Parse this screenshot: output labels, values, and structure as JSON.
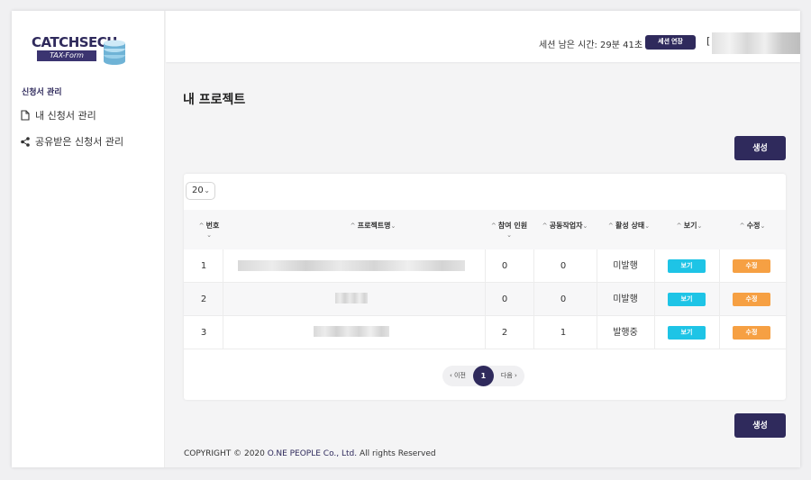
{
  "brand": {
    "logo_main": "CATCHSECU",
    "logo_sub": "TAX-Form"
  },
  "sidebar": {
    "section_title": "신청서 관리",
    "items": [
      {
        "label": "내 신청서 관리",
        "icon": "document-icon"
      },
      {
        "label": "공유받은 신청서 관리",
        "icon": "share-icon"
      }
    ]
  },
  "header": {
    "session_label": "세션 남은 시간:",
    "session_time": "29분 41초",
    "extend_button": "세션 연장",
    "bracket": "["
  },
  "main": {
    "title": "내 프로젝트",
    "create_button": "생성",
    "page_size": "20",
    "columns": [
      "번호",
      "프로젝트명",
      "참여 인원",
      "공동작업자",
      "활성 상태",
      "보기",
      "수정"
    ],
    "rows": [
      {
        "no": "1",
        "participants": "0",
        "collaborators": "0",
        "status": "미발행",
        "view": "보기",
        "edit": "수정"
      },
      {
        "no": "2",
        "participants": "0",
        "collaborators": "0",
        "status": "미발행",
        "view": "보기",
        "edit": "수정"
      },
      {
        "no": "3",
        "participants": "2",
        "collaborators": "1",
        "status": "발행중",
        "view": "보기",
        "edit": "수정"
      }
    ],
    "pagination": {
      "prev": "‹ 이전",
      "current": "1",
      "next": "다음 ›"
    }
  },
  "footer": {
    "copyright_prefix": "COPYRIGHT © 2020",
    "company": "O.NE PEOPLE Co., Ltd.",
    "rights": "All rights Reserved"
  },
  "colors": {
    "primary": "#2f2a5c",
    "view": "#1ec4e6",
    "edit": "#f6a043"
  }
}
